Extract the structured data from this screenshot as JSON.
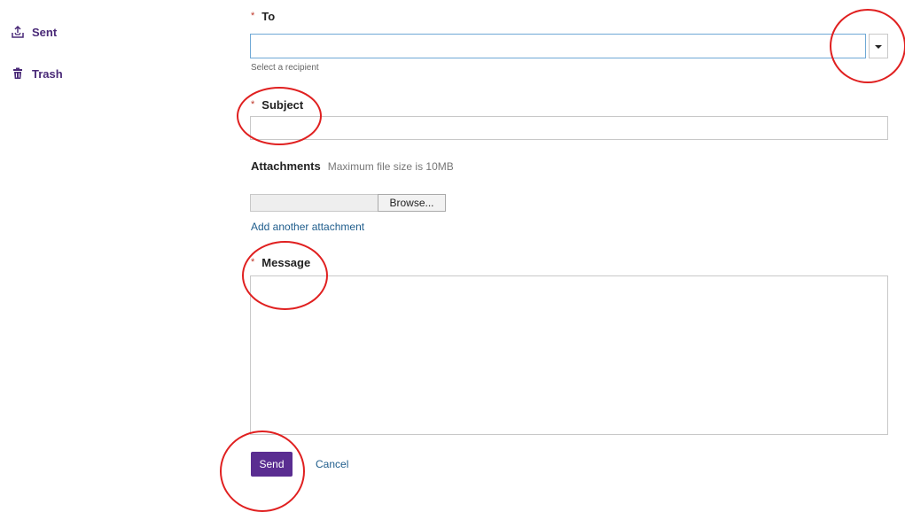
{
  "sidebar": {
    "items": [
      {
        "label": "Sent",
        "icon": "sent-tray-icon"
      },
      {
        "label": "Trash",
        "icon": "trash-icon"
      }
    ]
  },
  "form": {
    "to": {
      "required_mark": "*",
      "label": "To",
      "value": "",
      "hint": "Select a recipient"
    },
    "subject": {
      "required_mark": "*",
      "label": "Subject",
      "value": ""
    },
    "attachments": {
      "label": "Attachments",
      "note": "Maximum file size is 10MB",
      "browse_label": "Browse...",
      "add_link": "Add another attachment"
    },
    "message": {
      "required_mark": "*",
      "label": "Message",
      "value": ""
    },
    "actions": {
      "send_label": "Send",
      "cancel_label": "Cancel"
    }
  },
  "colors": {
    "brand": "#5a2d91",
    "link": "#1f5d8c",
    "required": "#c0392b",
    "annotation": "#e02020"
  }
}
